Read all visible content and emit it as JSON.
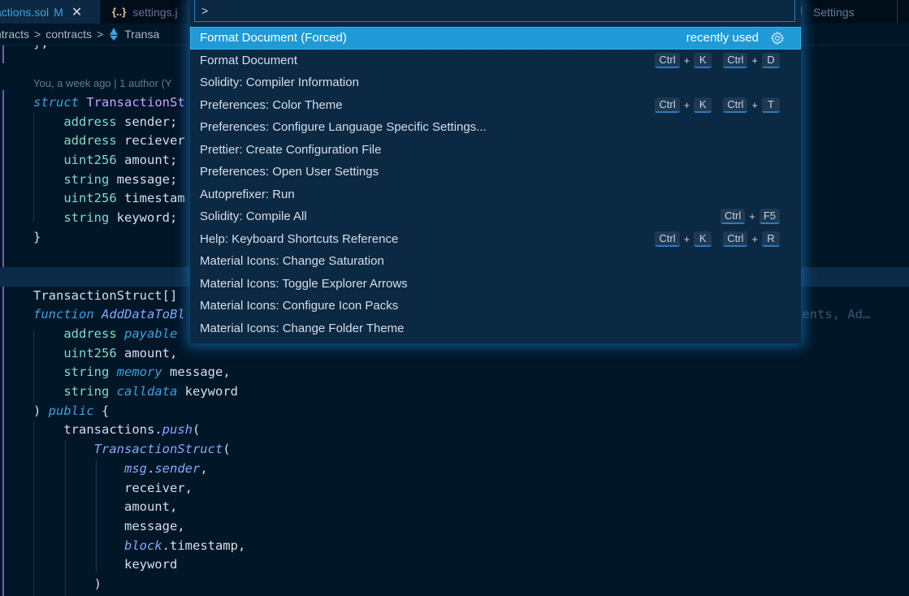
{
  "tabs": [
    {
      "name": "actions.sol",
      "modified": "M",
      "close": "✕",
      "active": true
    },
    {
      "name": "settings.j",
      "icon": "{..}",
      "active": false
    },
    {
      "name": "Settings",
      "active": false
    }
  ],
  "breadcrumb": [
    "ntracts",
    "contracts",
    "Transa"
  ],
  "breadcrumb_sep": ">",
  "editor": {
    "blame": "You, a week ago | 1 author (Y",
    "ghost_text": "nents, Ad…",
    "lines": [
      "};",
      "",
      "struct TransactionSt",
      "address sender;",
      "address reciever",
      "uint256 amount;",
      "string message;",
      "uint256 timestam",
      "string keyword;",
      "}",
      "",
      "TransactionStruct[]",
      "",
      "function AddDataToBl",
      "address payable",
      "uint256 amount,",
      "string memory message,",
      "string calldata keyword",
      ") public {",
      "transactions.push(",
      "TransactionStruct(",
      "msg.sender,",
      "receiver,",
      "amount,",
      "message,",
      "block.timestamp,",
      "keyword",
      ")"
    ]
  },
  "palette": {
    "input_value": ">",
    "recently_used_label": "recently used",
    "items": [
      {
        "label": "Format Document (Forced)",
        "selected": true,
        "recently_used": true
      },
      {
        "label": "Format Document",
        "keys": [
          [
            "Ctrl",
            "K"
          ],
          [
            "Ctrl",
            "D"
          ]
        ]
      },
      {
        "label": "Solidity: Compiler Information"
      },
      {
        "label": "Preferences: Color Theme",
        "keys": [
          [
            "Ctrl",
            "K"
          ],
          [
            "Ctrl",
            "T"
          ]
        ]
      },
      {
        "label": "Preferences: Configure Language Specific Settings..."
      },
      {
        "label": "Prettier: Create Configuration File"
      },
      {
        "label": "Preferences: Open User Settings"
      },
      {
        "label": "Autoprefixer: Run"
      },
      {
        "label": "Solidity: Compile All",
        "keys": [
          [
            "Ctrl",
            "F5"
          ]
        ]
      },
      {
        "label": "Help: Keyboard Shortcuts Reference",
        "keys": [
          [
            "Ctrl",
            "K"
          ],
          [
            "Ctrl",
            "R"
          ]
        ]
      },
      {
        "label": "Material Icons: Change Saturation"
      },
      {
        "label": "Material Icons: Toggle Explorer Arrows"
      },
      {
        "label": "Material Icons: Configure Icon Packs"
      },
      {
        "label": "Material Icons: Change Folder Theme"
      }
    ]
  },
  "colors": {
    "editor_bg": "#011627",
    "palette_bg": "#0b2942",
    "selection": "#1f9ad6",
    "accent": "#3aa2e0"
  }
}
